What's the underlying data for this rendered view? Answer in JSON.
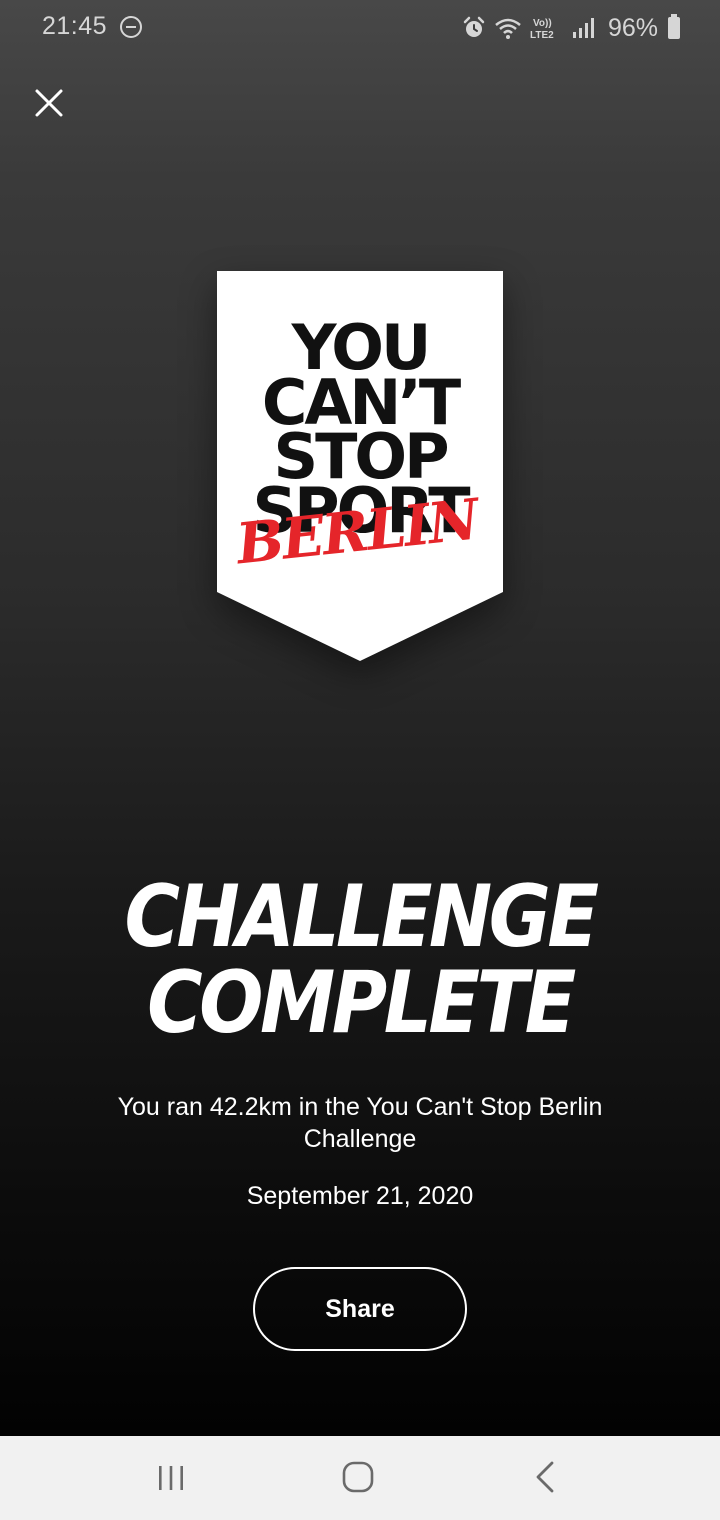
{
  "status_bar": {
    "time": "21:45",
    "battery_percent": "96%",
    "network_label": "Vo)) LTE2",
    "icons": [
      "do-not-disturb-icon",
      "alarm-icon",
      "wifi-icon",
      "volte-lte-icon",
      "signal-icon",
      "battery-icon"
    ]
  },
  "close_button": {
    "icon": "close-icon"
  },
  "badge": {
    "lines": [
      "YOU",
      "CAN’T",
      "STOP",
      "SPORT"
    ],
    "script": "BERLIN",
    "colors": {
      "background": "#ffffff",
      "text": "#111111",
      "script": "#e5252a"
    }
  },
  "headline": {
    "line1": "CHALLENGE",
    "line2": "COMPLETE"
  },
  "summary": "You ran 42.2km in the You Can't Stop Berlin Challenge",
  "date": "September 21, 2020",
  "share_button": {
    "label": "Share"
  },
  "nav_bar": {
    "icons": [
      "recent-apps-icon",
      "home-icon",
      "back-icon"
    ]
  }
}
